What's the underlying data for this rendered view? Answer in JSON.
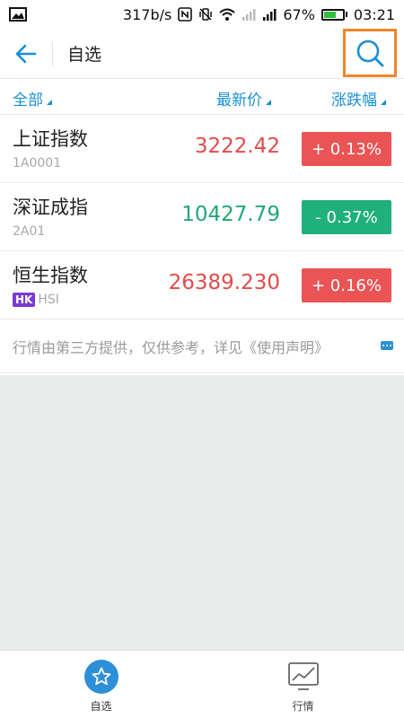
{
  "status_bar": {
    "speed": "317b/s",
    "battery": "67%",
    "battery_level": 0.67,
    "time": "03:21"
  },
  "header": {
    "title": "自选"
  },
  "columns": {
    "all": "全部",
    "price": "最新价",
    "change": "涨跌幅"
  },
  "rows": [
    {
      "name": "上证指数",
      "code": "1A0001",
      "badge": "",
      "price": "3222.42",
      "change": "+ 0.13%",
      "trend": "up"
    },
    {
      "name": "深证成指",
      "code": "2A01",
      "badge": "",
      "price": "10427.79",
      "change": "- 0.37%",
      "trend": "down"
    },
    {
      "name": "恒生指数",
      "code": "HSI",
      "badge": "HK",
      "price": "26389.230",
      "change": "+ 0.16%",
      "trend": "up"
    }
  ],
  "disclaimer": "行情由第三方提供，仅供参考，详见《使用声明》",
  "bottom_nav": [
    {
      "label": "自选",
      "icon": "star-icon",
      "active": true
    },
    {
      "label": "行情",
      "icon": "chart-icon",
      "active": false
    }
  ],
  "colors": {
    "accent": "#1a8fd3",
    "up": "#ea5454",
    "down": "#1fb07c",
    "highlight": "#f0862a"
  }
}
